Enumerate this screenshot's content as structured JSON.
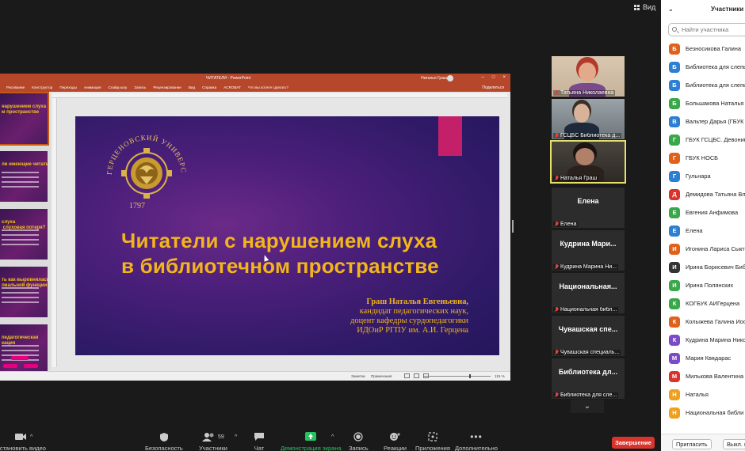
{
  "view_button": {
    "label": "Вид"
  },
  "ppt": {
    "title": "ЧИТАТЕЛИ - PowerPoint",
    "user": "Наталья Граш",
    "tabs": [
      "Рисование",
      "Конструктор",
      "Переходы",
      "Анимация",
      "Слайд-шоу",
      "Запись",
      "Рецензирование",
      "Вид",
      "Справка",
      "ACROBAT",
      "Что вы хотите сделать?"
    ],
    "share": "Поделиться",
    "thumbnails": [
      {
        "text": "нарушением слуха\nм пространстве"
      },
      {
        "text": "ли имеющие читать?"
      },
      {
        "text": "слуха\n слуховая потеря?"
      },
      {
        "text": "ть как выровнялась\nлиальной функции"
      },
      {
        "text": "педагогическая\nкация"
      }
    ],
    "slide": {
      "seal_text_top": "ГЕРЦЕНОВСКИЙ УНИВЕРСИТЕТ · HERZEN UNIVERSITY",
      "seal_year": "1797",
      "title_line1": "Читатели с нарушением слуха",
      "title_line2": "в библиотечном пространстве",
      "author_name": "Граш Наталья Евгеньевна,",
      "author_line2": "кандидат педагогических наук,",
      "author_line3": "доцент кафедры сурдопедагогики",
      "author_line4": "ИДОиР РГПУ им. А.И. Герцена"
    },
    "status": {
      "notes": "Заметки",
      "comments": "Примечания",
      "zoom": "115 %"
    }
  },
  "videos": [
    {
      "name": "Татьяна Николаевна",
      "type": "photo",
      "style": "ph1"
    },
    {
      "name": "ГСЦБС Библиотека д...",
      "type": "photo",
      "style": "ph2"
    },
    {
      "name": "Наталья Граш",
      "type": "photo",
      "style": "ph3",
      "active": true
    },
    {
      "name": "Елена",
      "big": "Елена",
      "type": "name"
    },
    {
      "name": "Кудрина Марина Ни...",
      "big": "Кудрина Мари...",
      "type": "name"
    },
    {
      "name": "Национальная библ...",
      "big": "Национальная...",
      "type": "name"
    },
    {
      "name": "Чувашская специаль...",
      "big": "Чувашская спе...",
      "type": "name"
    },
    {
      "name": "Библиотека для сле...",
      "big": "Библиотека дл...",
      "type": "name"
    }
  ],
  "panel": {
    "title": "Участники (",
    "search_placeholder": "Найти участника",
    "participants": [
      {
        "initial": "Б",
        "name": "Безносикова Галина",
        "color": "#e0611a"
      },
      {
        "initial": "Б",
        "name": "Библиотека для слепь",
        "color": "#2d7fd3"
      },
      {
        "initial": "Б",
        "name": "Библиотека для слепь",
        "color": "#2d7fd3"
      },
      {
        "initial": "Б",
        "name": "Большакова Наталья",
        "color": "#3aa84a"
      },
      {
        "initial": "В",
        "name": "Вальтер Дарья (ГБУК I",
        "color": "#2d7fd3"
      },
      {
        "initial": "Г",
        "name": "ГБУК ГСЦБС. Девонин",
        "color": "#3aa84a"
      },
      {
        "initial": "Г",
        "name": "ГБУК НОСБ",
        "color": "#e0611a"
      },
      {
        "initial": "Г",
        "name": "Гульнара",
        "color": "#2d7fd3"
      },
      {
        "initial": "Д",
        "name": "Демидова Татьяна Вла",
        "color": "#d9342b"
      },
      {
        "initial": "Е",
        "name": "Евгения Анфимова",
        "color": "#3aa84a"
      },
      {
        "initial": "Е",
        "name": "Елена",
        "color": "#2d7fd3"
      },
      {
        "initial": "И",
        "name": "Игонина Лариса Сыкт",
        "color": "#e0611a"
      },
      {
        "initial": "И",
        "name": "Ирина Борисевич Биб",
        "color": "#333333"
      },
      {
        "initial": "И",
        "name": "Ирина Полянских",
        "color": "#3aa84a"
      },
      {
        "initial": "К",
        "name": "КОГБУК АИГерцена",
        "color": "#3aa84a"
      },
      {
        "initial": "К",
        "name": "Колыжева Галина Иоо",
        "color": "#e0611a"
      },
      {
        "initial": "К",
        "name": "Кудрина Марина Нико",
        "color": "#7a4bc8"
      },
      {
        "initial": "М",
        "name": "Мария Квядарас",
        "color": "#7a4bc8"
      },
      {
        "initial": "М",
        "name": "Милькова Валентина I",
        "color": "#d9342b"
      },
      {
        "initial": "Н",
        "name": "Наталья",
        "color": "#f0a020"
      },
      {
        "initial": "Н",
        "name": "Национальная библи",
        "color": "#f0a020"
      }
    ],
    "invite": "Пригласить",
    "mute": "Выкл. в"
  },
  "toolbar": {
    "video": "Остановить видео",
    "security": "Безопасность",
    "participants": "Участники",
    "participants_count": "59",
    "chat": "Чат",
    "share": "Демонстрация экрана",
    "record": "Запись",
    "reactions": "Реакции",
    "apps": "Приложения",
    "more": "Дополнительно",
    "end": "Завершение"
  }
}
